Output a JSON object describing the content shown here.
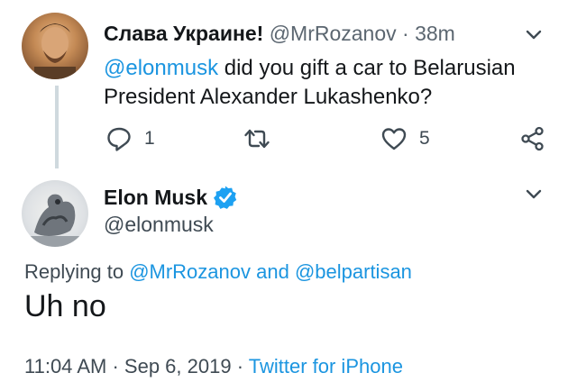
{
  "tweet1": {
    "author_name": "Слава Украине!",
    "author_handle": "@MrRozanov",
    "separator": "·",
    "time_ago": "38m",
    "mention": "@elonmusk",
    "text_rest": " did you gift a car to Belarusian President Alexander Lukashenko?",
    "reply_count": "1",
    "like_count": "5"
  },
  "tweet2": {
    "author_name": "Elon Musk",
    "author_handle": "@elonmusk",
    "replying_prefix": "Replying to ",
    "replying_user1": "@MrRozanov",
    "replying_and": " and ",
    "replying_user2": "@belpartisan",
    "text": "Uh no",
    "time": "11:04 AM",
    "separator": "·",
    "date": "Sep 6, 2019",
    "separator2": "·",
    "source": "Twitter for iPhone"
  },
  "icons": {
    "reply": "reply-icon",
    "retweet": "retweet-icon",
    "like": "heart-icon",
    "share": "share-icon",
    "verified": "verified-badge-icon",
    "chevron": "chevron-down-icon"
  },
  "colors": {
    "link": "#1b95e0",
    "verified": "#1da1f2",
    "text": "#14171a",
    "secondary": "#3f4a53"
  }
}
